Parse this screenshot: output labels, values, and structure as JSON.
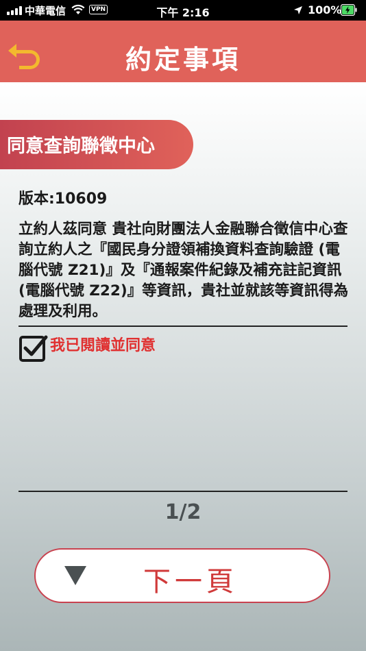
{
  "status_bar": {
    "carrier": "中華電信",
    "vpn": "VPN",
    "time": "下午 2:16",
    "battery_percent": "100%"
  },
  "header": {
    "title": "約定事項",
    "back_icon": "back-arrow-icon",
    "color": "#e0625a"
  },
  "section": {
    "title": "同意查詢聯徵中心"
  },
  "version": "版本:10609",
  "agreement_text": "立約人茲同意 貴社向財團法人金融聯合徵信中心查詢立約人之『國民身分證領補換資料查詢驗證 (電腦代號 Z21)』及『通報案件紀錄及補充註記資訊 (電腦代號 Z22)』等資訊，貴社並就該等資訊得為處理及利用。",
  "consent": {
    "label": "我已閱讀並同意",
    "checked": true,
    "color": "#e03030"
  },
  "pagination": {
    "indicator": "1/2"
  },
  "next_button": {
    "label": "下一頁",
    "icon": "triangle-down-icon"
  }
}
